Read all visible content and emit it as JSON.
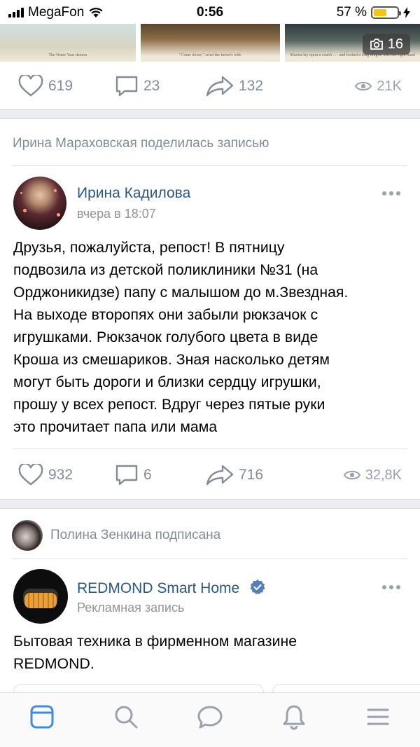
{
  "status_bar": {
    "carrier": "MegaFon",
    "time": "0:56",
    "battery_percent": "57 %",
    "battery_level": 0.57,
    "battery_color": "#f5c518"
  },
  "photos": {
    "captions": [
      "The Water Year dances",
      "\"Come down,\" cried the heron's wife",
      "Marina lay upon a couch . . . and looked a long dragon with her right hand"
    ],
    "count": "16"
  },
  "post1_actions": {
    "likes": "619",
    "comments": "23",
    "shares": "132",
    "views": "21K"
  },
  "post2": {
    "shared_by": "Ирина Мараховская поделилась записью",
    "author": "Ирина Кадилова",
    "time": "вчера в 18:07",
    "text_lines": [
      "Друзья, пожалуйста, репост! В пятницу",
      "подвозила из детской поликлиники №31 (на",
      "Орджоникидзе) папу с малышом до м.Звездная.",
      "На выходе второпях они забыли рюкзачок с",
      "игрушками. Рюкзачок голубого цвета в виде",
      "Кроша из  смешариков. Зная насколько детям",
      "могут быть дороги и близки сердцу игрушки,",
      "прошу у всех репост. Вдруг через пятые руки",
      "это прочитает папа или мама"
    ],
    "actions": {
      "likes": "932",
      "comments": "6",
      "shares": "716",
      "views": "32,8K"
    }
  },
  "post3": {
    "subscribed_line": "Полина Зенкина подписана",
    "author": "REDMOND Smart Home",
    "subline": "Рекламная запись",
    "text_lines": [
      "Бытовая техника в фирменном магазине",
      "REDMOND."
    ]
  },
  "tabbar": {
    "items": [
      "newsfeed-icon",
      "search-icon",
      "messages-icon",
      "notifications-icon",
      "menu-icon"
    ],
    "active_color": "#3f8ae0",
    "inactive_color": "#99a2ad"
  },
  "colors": {
    "link": "#2a5885",
    "meta": "#818c99",
    "verified": "#5181b8"
  }
}
